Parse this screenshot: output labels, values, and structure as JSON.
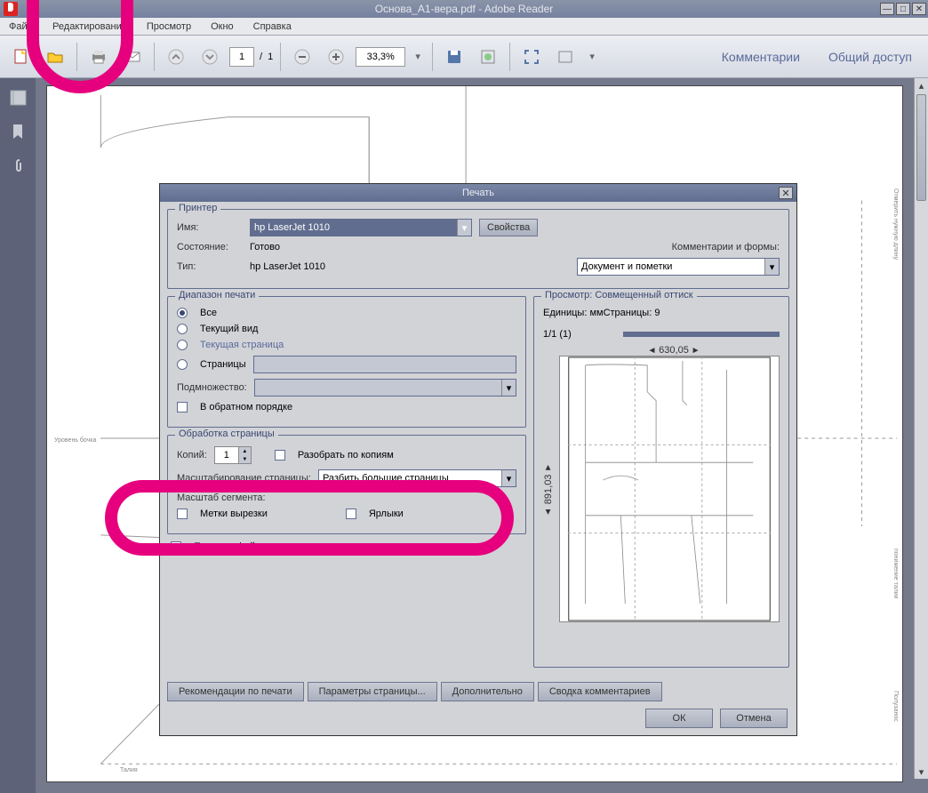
{
  "window": {
    "title": "Основа_А1-вера.pdf - Adobe Reader"
  },
  "menu": {
    "file": "Файл",
    "edit": "Редактирование",
    "view": "Просмотр",
    "window": "Окно",
    "help": "Справка"
  },
  "toolbar": {
    "current_page": "1",
    "page_sep": "/",
    "total_pages": "1",
    "zoom": "33,3%",
    "comments": "Комментарии",
    "share": "Общий доступ"
  },
  "doc_labels": {
    "urovenbochka": "Уровень бочка",
    "taliya": "Талия",
    "sidelabel1": "Отмерить нужную длину",
    "sidelabel2": "понижение талии",
    "sidelabel3": "Полузанос"
  },
  "print": {
    "title": "Печать",
    "printer_legend": "Принтер",
    "name_label": "Имя:",
    "name_value": "hp LaserJet 1010",
    "properties": "Свойства",
    "status_label": "Состояние:",
    "status_value": "Готово",
    "type_label": "Тип:",
    "type_value": "hp LaserJet 1010",
    "comments_forms_label": "Комментарии и формы:",
    "comments_forms_value": "Документ и пометки",
    "range_legend": "Диапазон печати",
    "range_all": "Все",
    "range_current_view": "Текущий вид",
    "range_current_page": "Текущая страница",
    "range_pages": "Страницы",
    "subset_label": "Подмножество:",
    "reverse_order": "В обратном порядке",
    "handling_legend": "Обработка страницы",
    "copies_label": "Копий:",
    "copies_value": "1",
    "collate": "Разобрать по копиям",
    "scaling_label": "Масштабирование страницы:",
    "scaling_value": "Разбить большие страницы",
    "scale_segment": "Масштаб сегмента:",
    "cut_marks": "Метки вырезки",
    "labels": "Ярлыки",
    "print_to_file": "Печать в файл",
    "preview_legend": "Просмотр: Совмещенный оттиск",
    "units_pages": "Единицы: ммСтраницы: 9",
    "page_indicator": "1/1 (1)",
    "width": "630,05",
    "height": "891,03",
    "tips": "Рекомендации по печати",
    "page_setup": "Параметры страницы...",
    "advanced": "Дополнительно",
    "summarize": "Сводка комментариев",
    "ok": "ОК",
    "cancel": "Отмена"
  }
}
